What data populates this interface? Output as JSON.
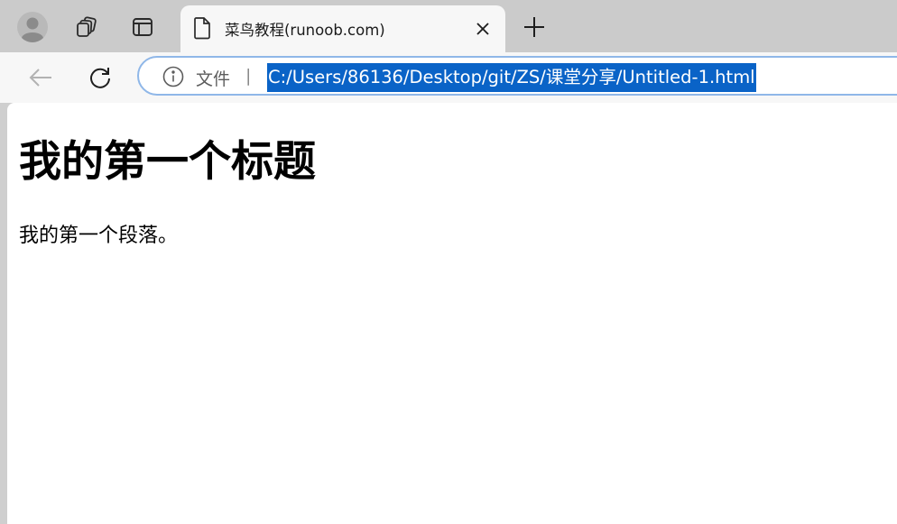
{
  "tab": {
    "title": "菜鸟教程(runoob.com)"
  },
  "addressbar": {
    "security_label": "文件",
    "separator": "|",
    "url": "C:/Users/86136/Desktop/git/ZS/课堂分享/Untitled-1.html"
  },
  "page": {
    "heading": "我的第一个标题",
    "paragraph": "我的第一个段落。"
  },
  "icons": {
    "avatar": "profile-avatar-icon",
    "workspaces": "workspaces-icon",
    "tab_actions": "tab-actions-icon",
    "tab_favicon": "document-icon",
    "tab_close": "close-icon",
    "new_tab": "plus-icon",
    "back": "back-arrow-icon",
    "refresh": "refresh-icon",
    "info": "info-icon"
  },
  "colors": {
    "selection": "#0a63c7",
    "address_border": "#8fb7e8",
    "tabstrip": "#cbcbcb",
    "toolbar": "#f7f7f7"
  }
}
